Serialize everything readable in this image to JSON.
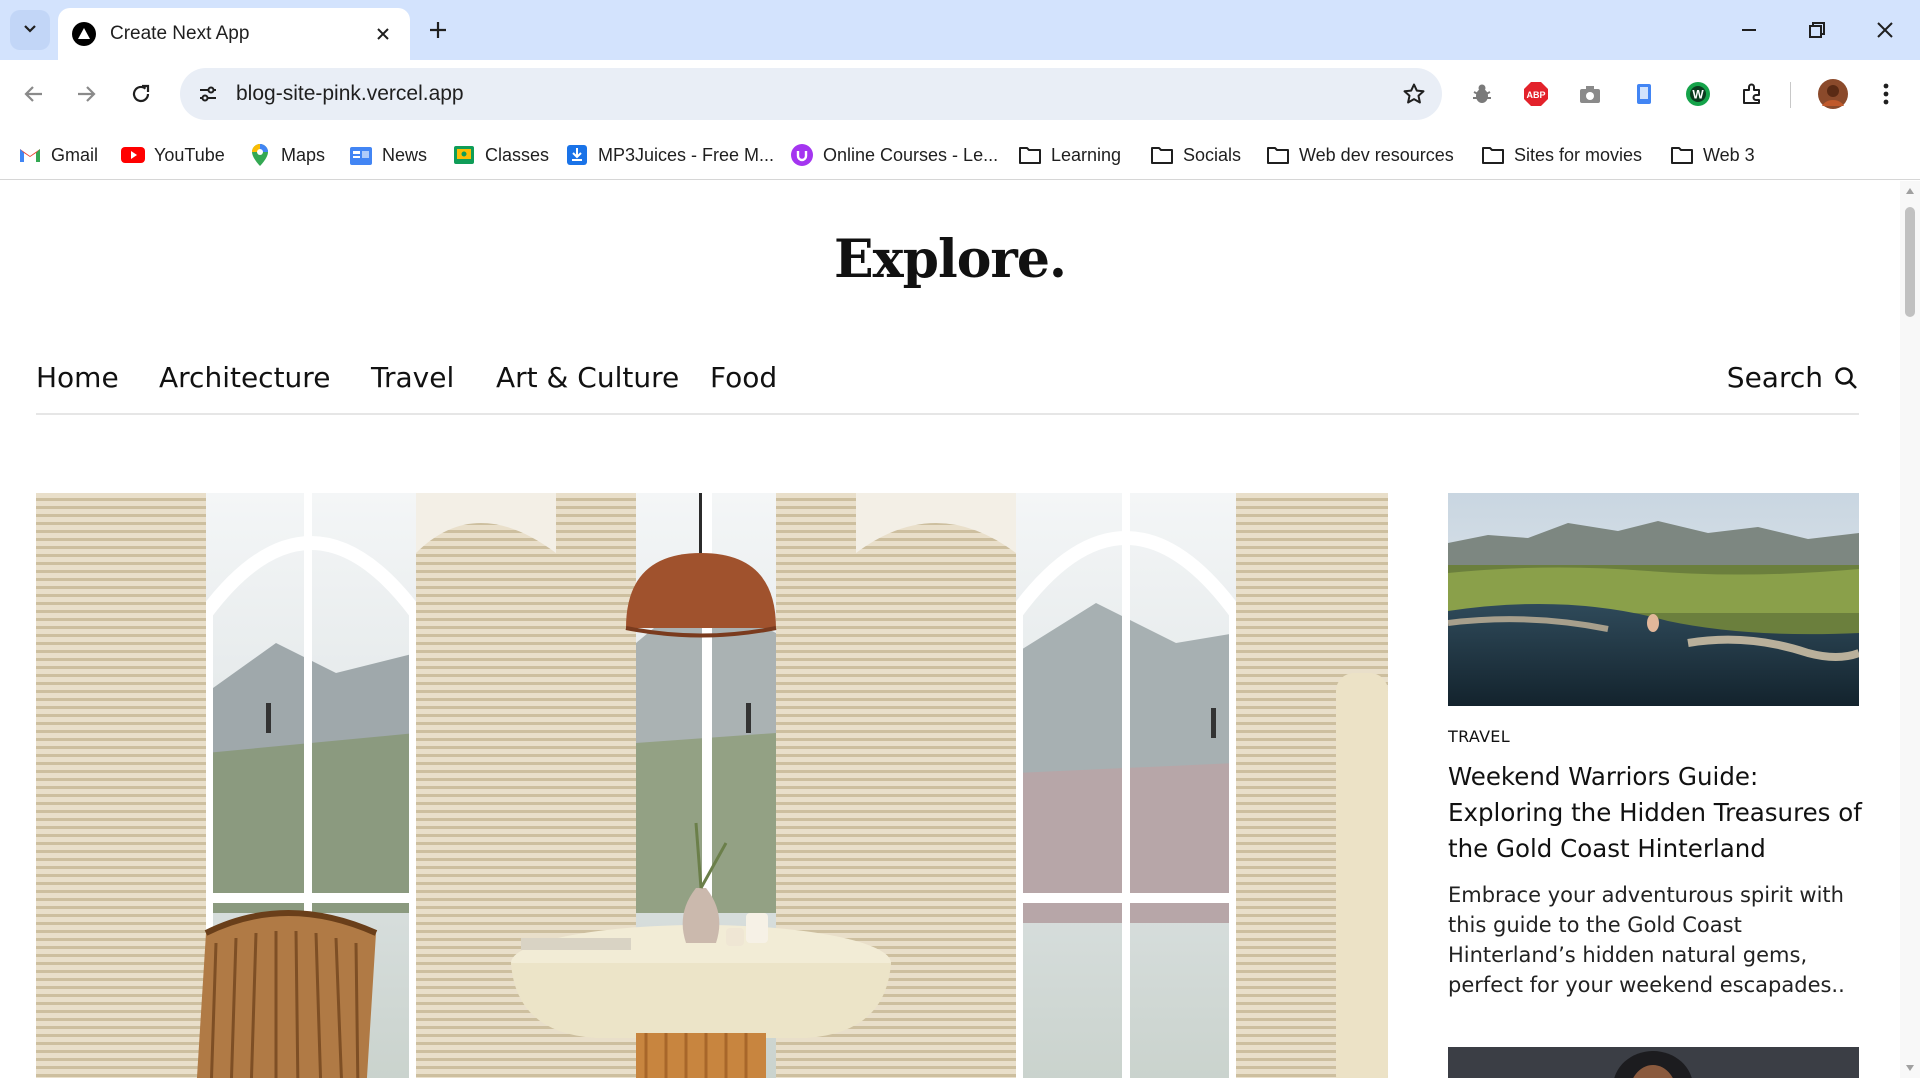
{
  "browser": {
    "tab_title": "Create Next App",
    "url": "blog-site-pink.vercel.app",
    "bookmarks": [
      {
        "label": "Gmail",
        "icon": "gmail-icon"
      },
      {
        "label": "YouTube",
        "icon": "youtube-icon"
      },
      {
        "label": "Maps",
        "icon": "maps-icon"
      },
      {
        "label": "News",
        "icon": "news-icon"
      },
      {
        "label": "Classes",
        "icon": "classes-icon"
      },
      {
        "label": "MP3Juices - Free M...",
        "icon": "download-icon"
      },
      {
        "label": "Online Courses - Le...",
        "icon": "udemy-icon"
      },
      {
        "label": "Learning",
        "icon": "folder-icon"
      },
      {
        "label": "Socials",
        "icon": "folder-icon"
      },
      {
        "label": "Web dev resources",
        "icon": "folder-icon"
      },
      {
        "label": "Sites for movies",
        "icon": "folder-icon"
      },
      {
        "label": "Web 3",
        "icon": "folder-icon"
      }
    ]
  },
  "site": {
    "logo": "Explore.",
    "nav": [
      "Home",
      "Architecture",
      "Travel",
      "Art & Culture",
      "Food"
    ],
    "search_label": "Search"
  },
  "feature_card": {
    "category": "TRAVEL",
    "title": "Weekend Warriors Guide: Exploring the Hidden Treasures of the Gold Coast Hinterland",
    "description": "Embrace your adventurous spirit with this guide to the Gold Coast Hinterland’s hidden natural gems, perfect for your weekend escapades.."
  },
  "colors": {
    "tabstrip": "#d3e3fd",
    "omnibox": "#e9eef6",
    "text": "#111111"
  }
}
